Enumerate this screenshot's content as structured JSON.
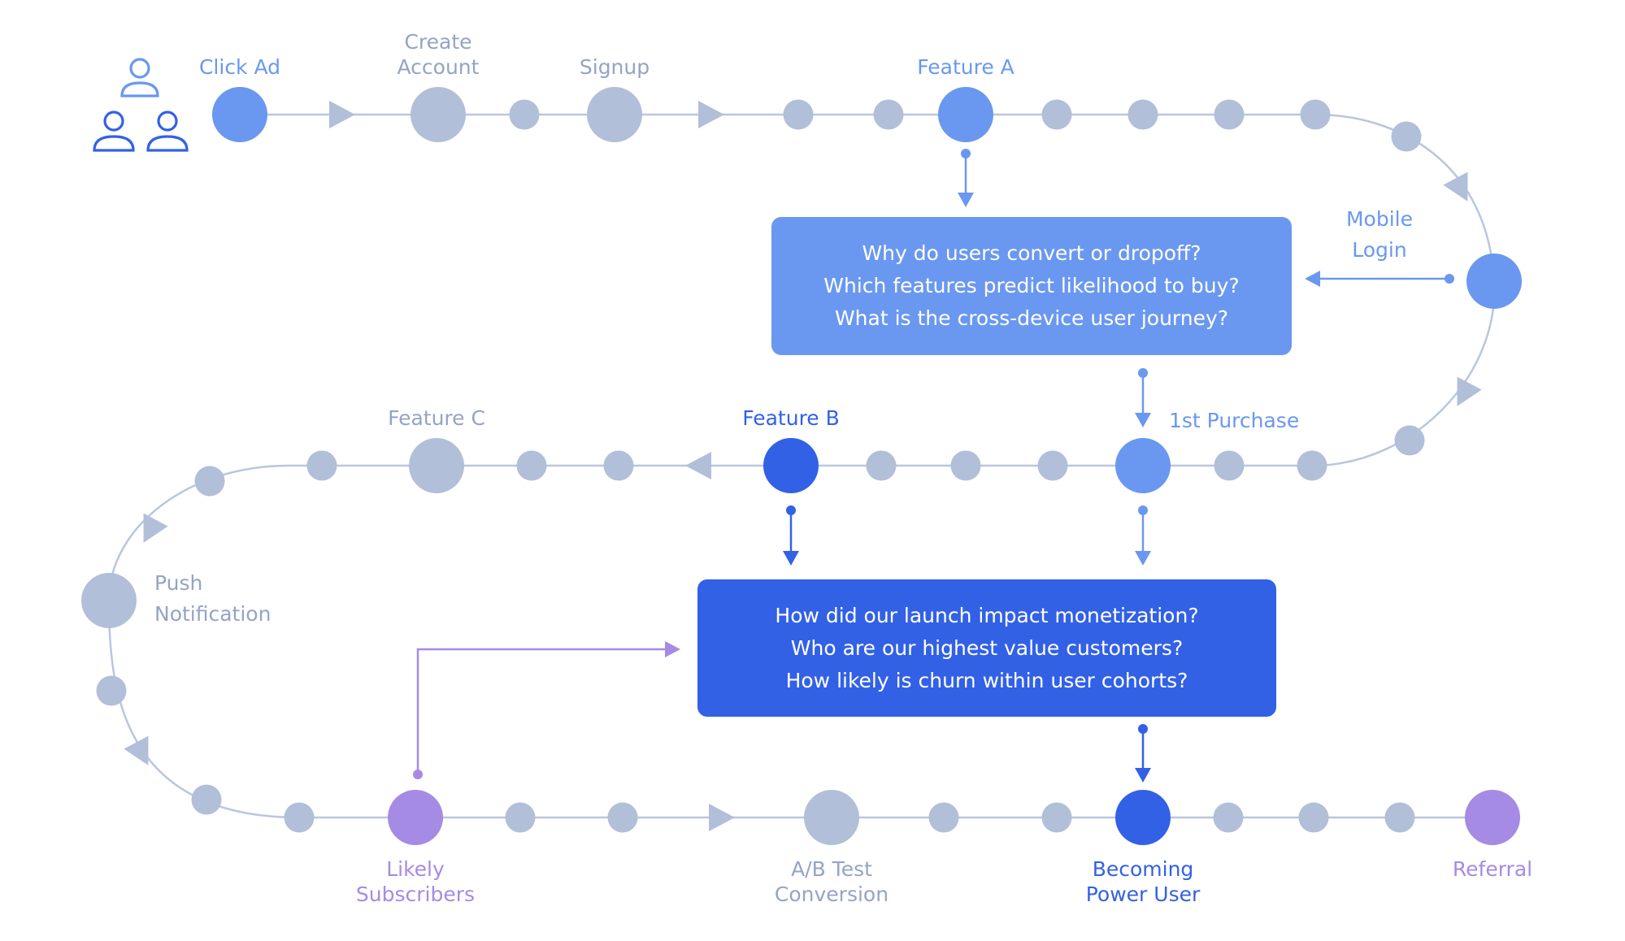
{
  "colors": {
    "gray": "#b1bfd9",
    "gray_text": "#95a4c5",
    "light_blue": "#6a98f0",
    "dark_blue": "#3261e6",
    "purple": "#a58be4",
    "line": "#b9c6de",
    "icon_light": "#6a98f0",
    "icon_dark": "#3261e6"
  },
  "users_icon": "users-group-icon",
  "nodes": [
    {
      "id": "click-ad",
      "label": [
        "Click Ad"
      ],
      "color": "light_blue",
      "size": "large",
      "label_pos": "above"
    },
    {
      "id": "create-account",
      "label": [
        "Create",
        "Account"
      ],
      "color": "gray",
      "size": "large",
      "label_pos": "above"
    },
    {
      "id": "signup",
      "label": [
        "Signup"
      ],
      "color": "gray",
      "size": "large",
      "label_pos": "above"
    },
    {
      "id": "feature-a",
      "label": [
        "Feature A"
      ],
      "color": "light_blue",
      "size": "large",
      "label_pos": "above"
    },
    {
      "id": "mobile-login",
      "label": [
        "Mobile",
        "Login"
      ],
      "color": "light_blue",
      "size": "large",
      "label_pos": "left"
    },
    {
      "id": "first-purchase",
      "label": [
        "1st Purchase"
      ],
      "color": "light_blue",
      "size": "large",
      "label_pos": "above-right"
    },
    {
      "id": "feature-b",
      "label": [
        "Feature B"
      ],
      "color": "dark_blue",
      "size": "large",
      "label_pos": "above"
    },
    {
      "id": "feature-c",
      "label": [
        "Feature C"
      ],
      "color": "gray",
      "size": "large",
      "label_pos": "above"
    },
    {
      "id": "push-notification",
      "label": [
        "Push",
        "Notification"
      ],
      "color": "gray",
      "size": "large",
      "label_pos": "right"
    },
    {
      "id": "likely-subscribers",
      "label": [
        "Likely",
        "Subscribers"
      ],
      "color": "purple",
      "size": "large",
      "label_pos": "below"
    },
    {
      "id": "ab-test-conversion",
      "label": [
        "A/B Test",
        "Conversion"
      ],
      "color": "gray",
      "size": "large",
      "label_pos": "below"
    },
    {
      "id": "becoming-power-user",
      "label": [
        "Becoming",
        "Power User"
      ],
      "color": "dark_blue",
      "size": "large",
      "label_pos": "below"
    },
    {
      "id": "referral",
      "label": [
        "Referral"
      ],
      "color": "purple",
      "size": "large",
      "label_pos": "below"
    }
  ],
  "boxes": [
    {
      "id": "box-1",
      "color": "light_blue",
      "lines": [
        "Why do users convert or dropoff?",
        "Which features predict likelihood to buy?",
        "What is the cross-device user journey?"
      ]
    },
    {
      "id": "box-2",
      "color": "dark_blue",
      "lines": [
        "How did our launch impact monetization?",
        "Who are our highest value customers?",
        "How likely is churn within user cohorts?"
      ]
    }
  ],
  "connectors": [
    {
      "from": "feature-a",
      "to": "box-1",
      "color": "light_blue"
    },
    {
      "from": "mobile-login",
      "to": "box-1",
      "color": "light_blue"
    },
    {
      "from": "box-1",
      "to": "first-purchase",
      "color": "light_blue"
    },
    {
      "from": "feature-b",
      "to": "box-2",
      "color": "dark_blue"
    },
    {
      "from": "first-purchase",
      "to": "box-2",
      "color": "light_blue"
    },
    {
      "from": "box-2",
      "to": "becoming-power-user",
      "color": "dark_blue"
    },
    {
      "from": "likely-subscribers",
      "to": "box-2",
      "color": "purple"
    }
  ]
}
